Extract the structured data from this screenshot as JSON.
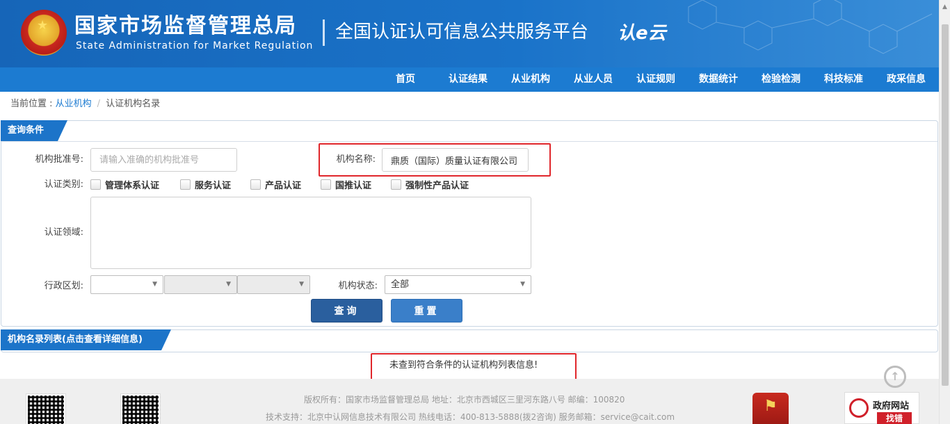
{
  "header": {
    "title_cn": "国家市场监督管理总局",
    "title_en": "State Administration  for  Market Regulation",
    "platform": "全国认证认可信息公共服务平台",
    "logo_text": "认e云"
  },
  "nav": {
    "items": [
      "首页",
      "认证结果",
      "从业机构",
      "从业人员",
      "认证规则",
      "数据统计",
      "检验检测",
      "科技标准",
      "政采信息"
    ]
  },
  "breadcrumb": {
    "prefix": "当前位置 : ",
    "link": "从业机构",
    "separator": "/",
    "current": "认证机构名录"
  },
  "query_panel": {
    "title": "查询条件",
    "approval_no": {
      "label": "机构批准号:",
      "placeholder": "请输入准确的机构批准号",
      "value": ""
    },
    "org_name": {
      "label": "机构名称:",
      "value": "鼎质（国际）质量认证有限公司"
    },
    "cert_type": {
      "label": "认证类别:",
      "options": [
        "管理体系认证",
        "服务认证",
        "产品认证",
        "国推认证",
        "强制性产品认证"
      ]
    },
    "cert_field": {
      "label": "认证领域:"
    },
    "region": {
      "label": "行政区划:",
      "values": [
        "",
        "",
        ""
      ]
    },
    "status": {
      "label": "机构状态:",
      "value": "全部"
    },
    "query_button": "查询",
    "reset_button": "重置"
  },
  "result_panel": {
    "title": "机构名录列表(点击查看详细信息)",
    "empty_message": "未查到符合条件的认证机构列表信息!"
  },
  "footer": {
    "line1": "版权所有：国家市场监督管理总局    地址：北京市西城区三里河东路八号    邮编：100820",
    "line2": "技术支持：北京中认网信息技术有限公司    热线电话：400-813-5888(拨2咨询)    服务邮箱：service@cait.com",
    "gov_badge_top": "政府网站",
    "gov_badge_bottom": "找错"
  },
  "colors": {
    "header_blue": "#1665b8",
    "nav_blue": "#1c7bd1",
    "highlight_red": "#e0262b",
    "query_button": "#2a5f9e",
    "reset_button": "#3a7fc9"
  }
}
